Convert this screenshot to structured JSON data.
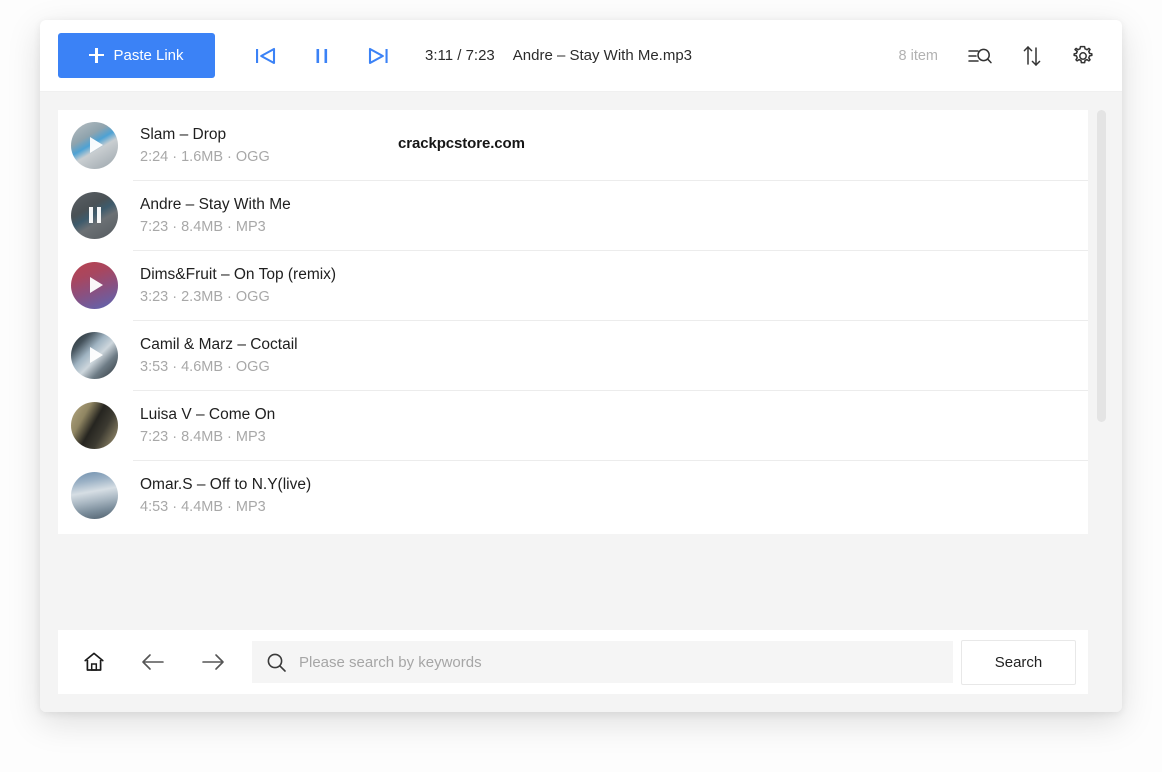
{
  "toolbar": {
    "paste_label": "Paste Link",
    "plus_icon": "plus-icon",
    "prev_icon": "previous-track-icon",
    "pause_icon": "pause-icon",
    "next_icon": "next-track-icon",
    "time": "3:11 / 7:23",
    "now_playing": "Andre – Stay With Me.mp3",
    "item_count": "8 item",
    "filter_icon": "list-search-icon",
    "sort_icon": "sort-arrows-icon",
    "settings_icon": "gear-icon",
    "accent_color": "#3b82f6"
  },
  "watermark": "crackpcstore.com",
  "tracks": [
    {
      "title": "Slam – Drop",
      "sub": "2:24 · 1.6MB · OGG",
      "state": "play"
    },
    {
      "title": "Andre – Stay With Me",
      "sub": "7:23 · 8.4MB · MP3",
      "state": "pause"
    },
    {
      "title": "Dims&Fruit – On Top (remix)",
      "sub": "3:23 · 2.3MB · OGG",
      "state": "play"
    },
    {
      "title": "Camil & Marz – Coctail",
      "sub": "3:53 · 4.6MB · OGG",
      "state": "play"
    },
    {
      "title": "Luisa V – Come On",
      "sub": "7:23 · 8.4MB · MP3",
      "state": "none"
    },
    {
      "title": "Omar.S – Off to N.Y(live)",
      "sub": "4:53 · 4.4MB · MP3",
      "state": "none"
    }
  ],
  "search": {
    "home_icon": "home-icon",
    "back_icon": "back-arrow-icon",
    "forward_icon": "forward-arrow-icon",
    "search_icon": "search-icon",
    "placeholder": "Please search by keywords",
    "value": "",
    "button_label": "Search"
  }
}
